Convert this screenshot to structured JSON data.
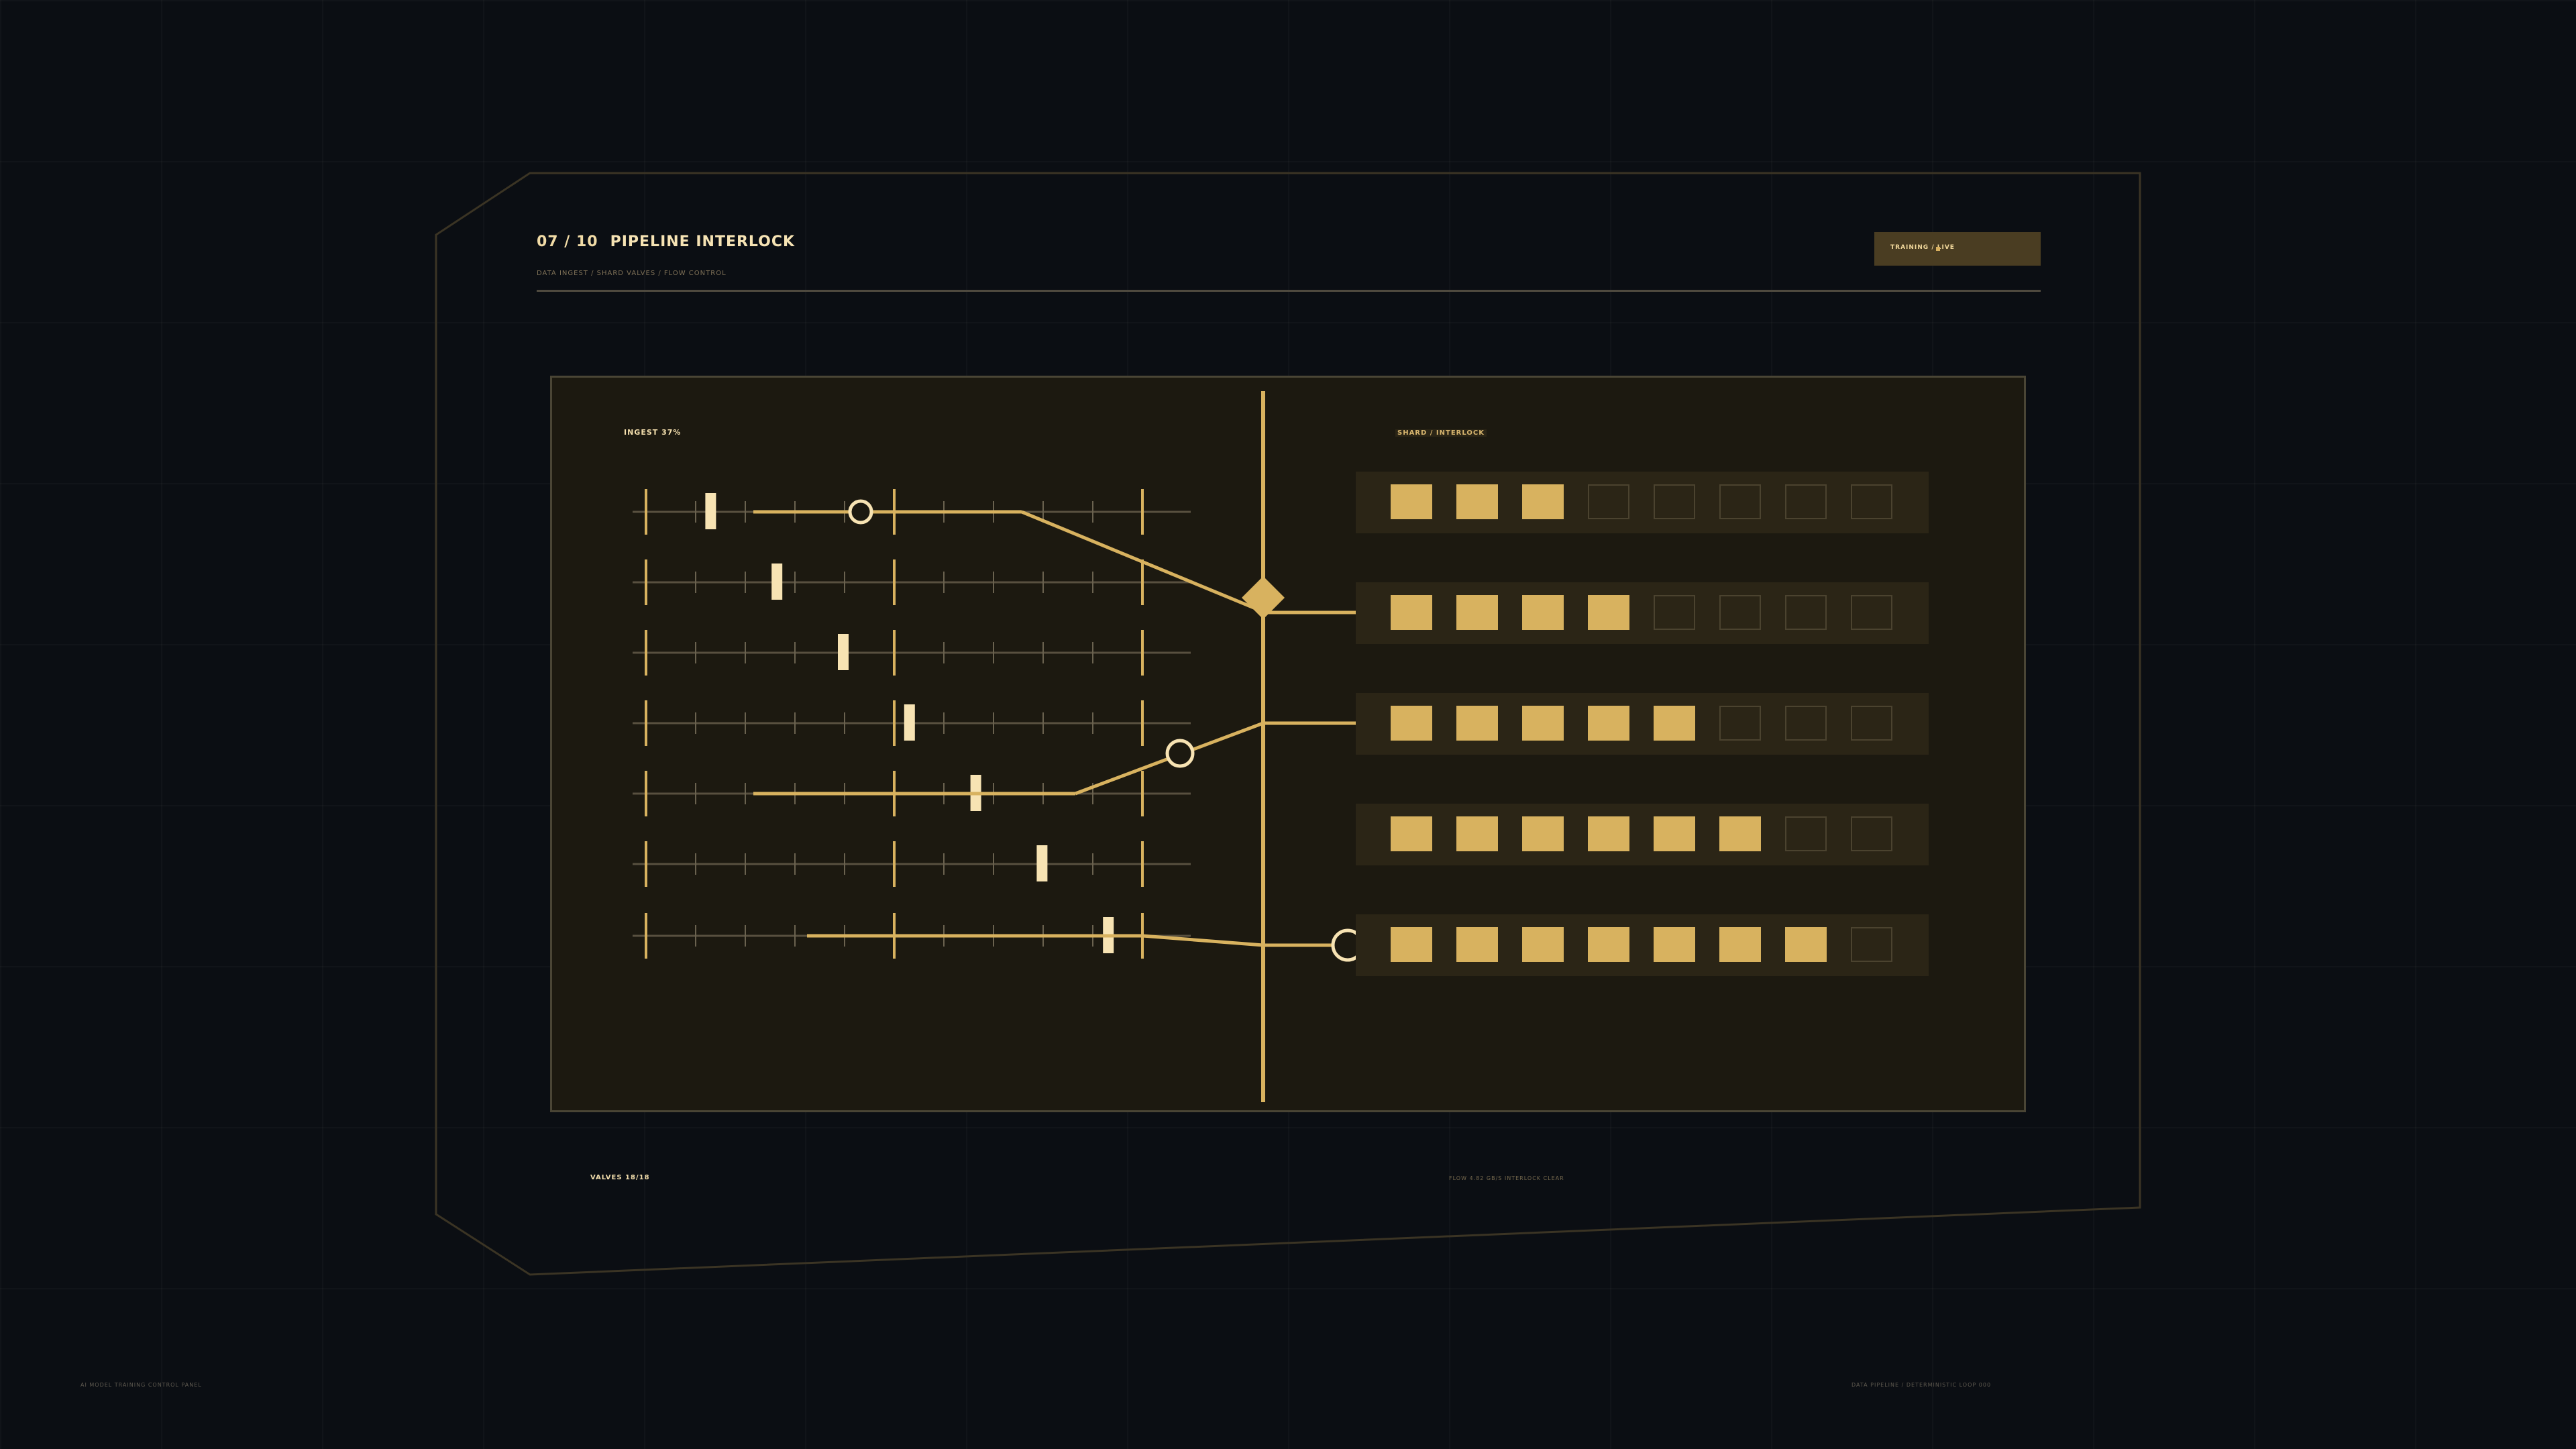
{
  "header": {
    "step": "07 / 10",
    "title": "PIPELINE INTERLOCK",
    "subtitle": "DATA INGEST / SHARD VALVES / FLOW CONTROL",
    "status": "TRAINING / LIVE"
  },
  "panel": {
    "ingest_label": "INGEST 37%",
    "shard_label": "SHARD / INTERLOCK",
    "ingest_rows": [
      {
        "id": "r1",
        "valve_position": 0.14
      },
      {
        "id": "r2",
        "valve_position": 0.27
      },
      {
        "id": "r3",
        "valve_position": 0.4
      },
      {
        "id": "r4",
        "valve_position": 0.53
      },
      {
        "id": "r5",
        "valve_position": 0.66
      },
      {
        "id": "r6",
        "valve_position": 0.79
      },
      {
        "id": "r7",
        "valve_position": 0.92
      }
    ],
    "shard_rows": [
      {
        "filled": 3,
        "total": 8
      },
      {
        "filled": 4,
        "total": 8
      },
      {
        "filled": 5,
        "total": 8
      },
      {
        "filled": 6,
        "total": 8
      },
      {
        "filled": 7,
        "total": 8
      }
    ]
  },
  "footer": {
    "valves": "VALVES 18/18",
    "flow": "FLOW 4.82 GB/S  INTERLOCK CLEAR",
    "left_note": "AI MODEL TRAINING CONTROL PANEL",
    "right_note": "DATA PIPELINE / DETERMINISTIC LOOP 000"
  },
  "colors": {
    "accent": "#d8b25f",
    "accent_light": "#f7e3b3",
    "panel_bg": "#1c1910"
  }
}
